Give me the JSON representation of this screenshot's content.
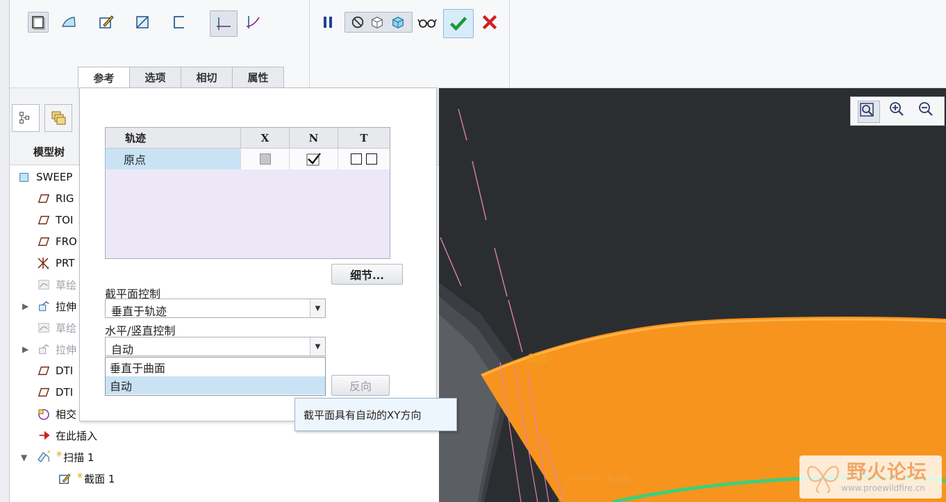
{
  "tabs": [
    "参考",
    "选项",
    "相切",
    "属性"
  ],
  "tree": {
    "title": "模型树",
    "items": [
      {
        "label": "SWEEP",
        "icon": "part-icon",
        "dim": false
      },
      {
        "label": "RIG",
        "icon": "datum-plane-icon",
        "dim": false
      },
      {
        "label": "TOI",
        "icon": "datum-plane-icon",
        "dim": false
      },
      {
        "label": "FRO",
        "icon": "datum-plane-icon",
        "dim": false
      },
      {
        "label": "PRT",
        "icon": "coordinate-system-icon",
        "dim": false
      },
      {
        "label": "草绘",
        "icon": "sketch-icon",
        "dim": true
      },
      {
        "label": "拉伸",
        "icon": "extrude-icon",
        "dim": false
      },
      {
        "label": "草绘",
        "icon": "sketch-icon",
        "dim": true
      },
      {
        "label": "拉伸",
        "icon": "extrude-icon",
        "dim": true
      },
      {
        "label": "DTI",
        "icon": "datum-plane-icon",
        "dim": false
      },
      {
        "label": "DTI",
        "icon": "datum-plane-icon",
        "dim": false
      },
      {
        "label": "相交",
        "icon": "intersect-icon",
        "dim": false
      },
      {
        "label": "在此插入",
        "icon": "insert-here-icon",
        "dim": false
      },
      {
        "label": "扫描 1",
        "icon": "sweep-icon",
        "dim": false
      },
      {
        "label": "截面 1",
        "icon": "section-icon",
        "dim": false
      }
    ]
  },
  "dialog": {
    "table": {
      "headers": [
        "轨迹",
        "X",
        "N",
        "T"
      ],
      "rows": [
        {
          "name": "原点"
        }
      ]
    },
    "details_button": "细节...",
    "section_control_label": "截平面控制",
    "section_control_value": "垂直于轨迹",
    "hv_control_label": "水平/竖直控制",
    "hv_control_value": "自动",
    "dropdown_options": [
      "垂直于曲面",
      "自动"
    ],
    "selected_option": "自动",
    "reverse_button": "反向",
    "tooltip": "截平面具有自动的XY方向"
  },
  "viewport": {
    "section_label": "截面",
    "dimension_value": "0.00",
    "background_color": "#2b2e31",
    "surface_color": "#f7941d",
    "trajectory_color": "#3cd07a"
  },
  "watermark": {
    "title": "野火论坛",
    "url": "www.proewildfire.cn"
  }
}
